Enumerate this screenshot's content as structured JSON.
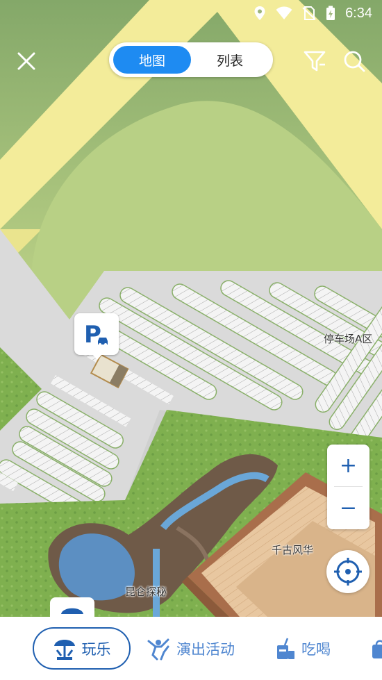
{
  "status_bar": {
    "time": "6:34"
  },
  "header": {
    "tabs": [
      {
        "label": "地图",
        "active": true
      },
      {
        "label": "列表",
        "active": false
      }
    ]
  },
  "map": {
    "labels": {
      "parking_a": "停车场A区",
      "qiangu": "千古风华",
      "kunlun": "昆仑探秘"
    },
    "parking_marker": {
      "letter": "P",
      "icon": "parking-car-icon"
    }
  },
  "controls": {
    "zoom_in": "+",
    "zoom_out": "−"
  },
  "categories": [
    {
      "label": "玩乐",
      "icon": "umbrella-ride-icon",
      "active": true
    },
    {
      "label": "演出活动",
      "icon": "performer-icon",
      "active": false
    },
    {
      "label": "吃喝",
      "icon": "drink-icon",
      "active": false
    },
    {
      "label": "",
      "icon": "shopping-bag-icon",
      "active": false
    }
  ],
  "colors": {
    "accent_blue": "#1e8bf2",
    "dark_blue": "#1f5fb0",
    "light_blue": "#4f86d0",
    "parking_gray": "#dadada",
    "grass_green": "#86b35c",
    "road_yellow": "#f3ec9a"
  }
}
